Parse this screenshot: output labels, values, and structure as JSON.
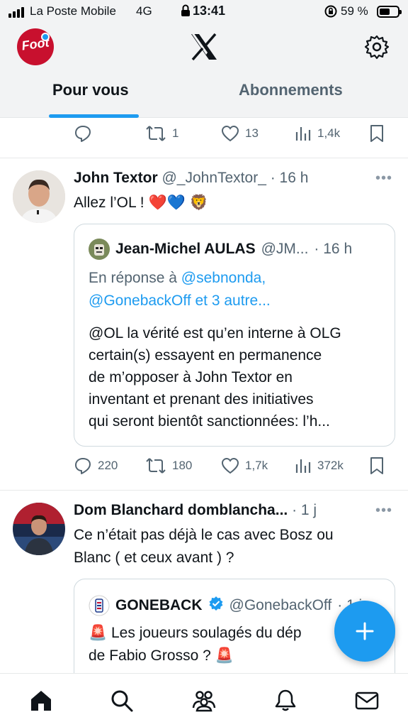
{
  "status_bar": {
    "carrier": "La Poste Mobile",
    "network": "4G",
    "time": "13:41",
    "battery_pct": "59 %",
    "battery_level": 0.59,
    "icons": [
      "signal-icon",
      "lock-icon",
      "orientation-lock-icon",
      "battery-icon"
    ]
  },
  "header": {
    "tabs": [
      {
        "label": "Pour vous",
        "active": true
      },
      {
        "label": "Abonnements",
        "active": false
      }
    ],
    "icons": [
      "profile-avatar",
      "x-logo-icon",
      "settings-gear-icon"
    ]
  },
  "previous_tweet_actions": {
    "replies": "",
    "retweets": "1",
    "likes": "13",
    "views": "1,4k"
  },
  "tweets": [
    {
      "name": "John Textor",
      "handle": "@_JohnTextor_",
      "time": "· 16 h",
      "text": "Allez l’OL !",
      "emojis": [
        "❤️",
        "💙",
        "🦁"
      ],
      "quote": {
        "name": "Jean-Michel AULAS",
        "handle": "@JM...",
        "time": "· 16 h",
        "reply_prefix": "En réponse à",
        "reply_to_1": "@sebnonda,",
        "reply_to_2": "@GonebackOff et 3 autre...",
        "text_lines": [
          "@OL la vérité est qu’en interne à OLG",
          "certain(s) essayent en permanence",
          "de m’opposer à John Textor en",
          "inventant et prenant des initiatives",
          "qui seront bientôt sanctionnées: l’h..."
        ]
      },
      "actions": {
        "replies": "220",
        "retweets": "180",
        "likes": "1,7k",
        "views": "372k"
      }
    },
    {
      "name": "Dom Blanchard",
      "handle": "domblancha...",
      "time": "· 1 j",
      "text_lines": [
        "Ce n’était pas déjà le cas avec Bosz ou",
        "Blanc ( et ceux avant ) ?"
      ],
      "quote": {
        "name": "GONEBACK",
        "handle": "@GonebackOff",
        "time": "· 1 j",
        "text_line_1": "Les joueurs soulagés du dép",
        "text_line_2": "de Fabio Grosso ?",
        "emoji": "🚨"
      }
    }
  ],
  "fab": {
    "icon": "plus-icon"
  },
  "bottom_nav": [
    "home-icon",
    "search-icon",
    "communities-icon",
    "notifications-bell-icon",
    "messages-envelope-icon"
  ],
  "colors": {
    "accent": "#1d9bf0",
    "text_primary": "#0f1419",
    "text_secondary": "#536471",
    "header_bg": "#f2f3f4",
    "heart_red": "#e0245e"
  }
}
